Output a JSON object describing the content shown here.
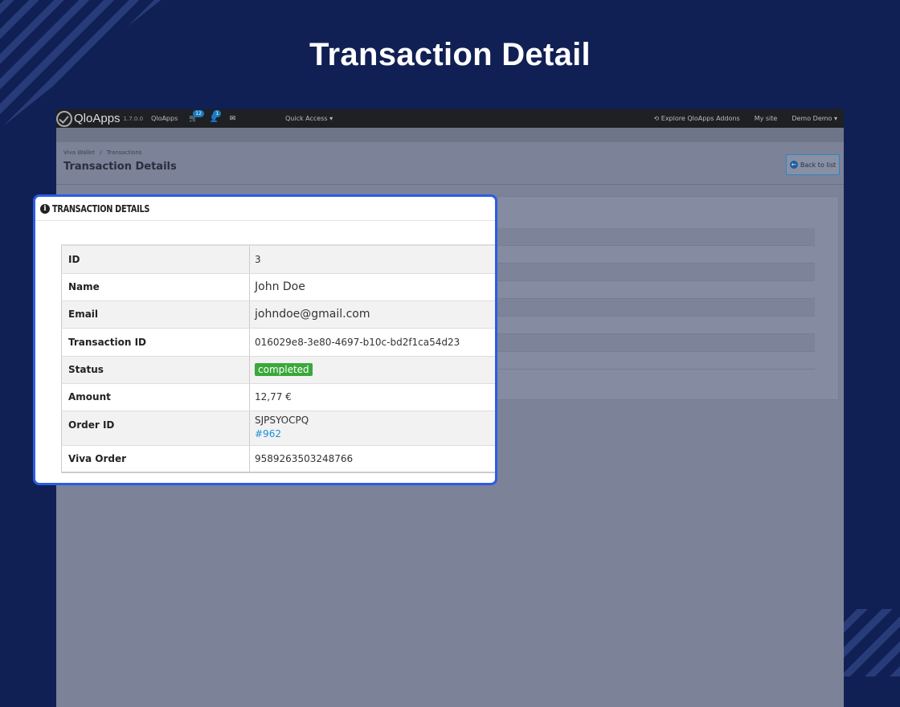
{
  "hero": {
    "title": "Transaction Detail"
  },
  "topbar": {
    "logo": "QloApps",
    "version": "1.7.0.0",
    "shop_link": "QloApps",
    "cart_badge": "12",
    "customer_badge": "1",
    "quick_access": "Quick Access",
    "addons": "Explore QloApps Addons",
    "my_site": "My site",
    "user": "Demo Demo"
  },
  "breadcrumb": {
    "item1": "Viva Wallet",
    "separator": "/",
    "item2": "Transactions"
  },
  "page_title": "Transaction Details",
  "back_button": "Back to list",
  "card": {
    "title": "TRANSACTION DETAILS",
    "rows": [
      {
        "label": "ID",
        "value": "3"
      },
      {
        "label": "Name",
        "value": "John Doe"
      },
      {
        "label": "Email",
        "value": "johndoe@gmail.com"
      },
      {
        "label": "Transaction ID",
        "value": "016029e8-3e80-4697-b10c-bd2f1ca54d23"
      },
      {
        "label": "Status",
        "value": "completed"
      },
      {
        "label": "Amount",
        "value": "12,77 €"
      },
      {
        "label": "Order ID",
        "value": "SJPSYOCPQ",
        "link": "#962"
      },
      {
        "label": "Viva Order",
        "value": "9589263503248766"
      }
    ]
  },
  "colors": {
    "background": "#112054",
    "card_border": "#2c5ce6",
    "status_green": "#3aa83a",
    "link_blue": "#1b8fd8"
  }
}
